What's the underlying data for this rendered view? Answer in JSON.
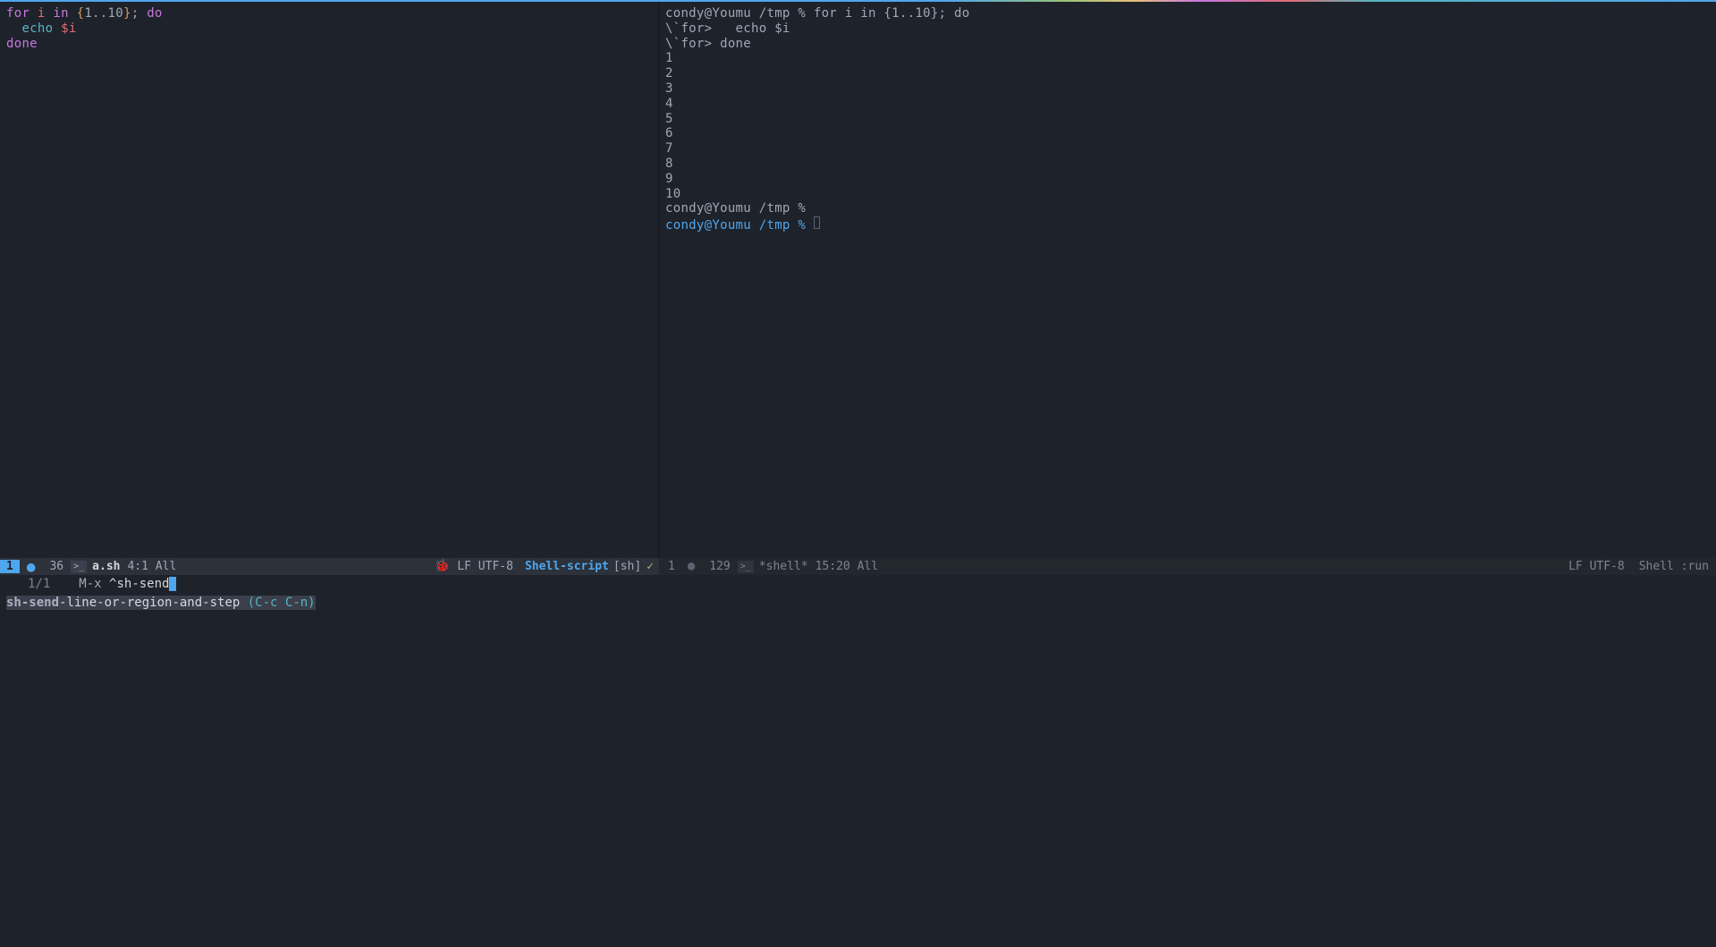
{
  "editor": {
    "lines": [
      {
        "tokens": [
          {
            "t": "for",
            "c": "keyword-for"
          },
          {
            "t": " ",
            "c": "text-normal"
          },
          {
            "t": "i",
            "c": "var-i"
          },
          {
            "t": " ",
            "c": "text-normal"
          },
          {
            "t": "in",
            "c": "keyword-in"
          },
          {
            "t": " ",
            "c": "text-normal"
          },
          {
            "t": "{",
            "c": "brace"
          },
          {
            "t": "1..10",
            "c": "text-normal"
          },
          {
            "t": "}",
            "c": "brace"
          },
          {
            "t": "; ",
            "c": "text-normal"
          },
          {
            "t": "do",
            "c": "keyword-do"
          }
        ]
      },
      {
        "tokens": [
          {
            "t": "  ",
            "c": "text-normal"
          },
          {
            "t": "echo",
            "c": "keyword-echo"
          },
          {
            "t": " ",
            "c": "text-normal"
          },
          {
            "t": "$i",
            "c": "dollar-var"
          }
        ]
      },
      {
        "tokens": [
          {
            "t": "done",
            "c": "keyword-done"
          }
        ]
      }
    ]
  },
  "terminal": {
    "lines": [
      "condy@Youmu /tmp % for i in {1..10}; do",
      "\\`for>   echo $i",
      "\\`for> done",
      "1",
      "2",
      "3",
      "4",
      "5",
      "6",
      "7",
      "8",
      "9",
      "10",
      "condy@Youmu /tmp %"
    ],
    "active_prompt": "condy@Youmu /tmp % "
  },
  "statusline_left": {
    "workspace": "1",
    "filesize": "36",
    "filename": "a.sh",
    "position": "4:1",
    "scroll": "All",
    "encoding": "LF UTF-8",
    "mode": "Shell-script",
    "mode_suffix": "[sh]"
  },
  "statusline_right": {
    "workspace": "1",
    "filesize": "129",
    "filename": "*shell*",
    "position": "15:20",
    "scroll": "All",
    "encoding": "LF UTF-8",
    "mode": "Shell :run"
  },
  "minibuffer": {
    "count": "1/1",
    "prompt": "M-x",
    "input_prefix": "^",
    "input": "sh-send",
    "completion_text": "sh-send-line-or-region-and-step",
    "completion_key": "(C-c C-n)"
  }
}
